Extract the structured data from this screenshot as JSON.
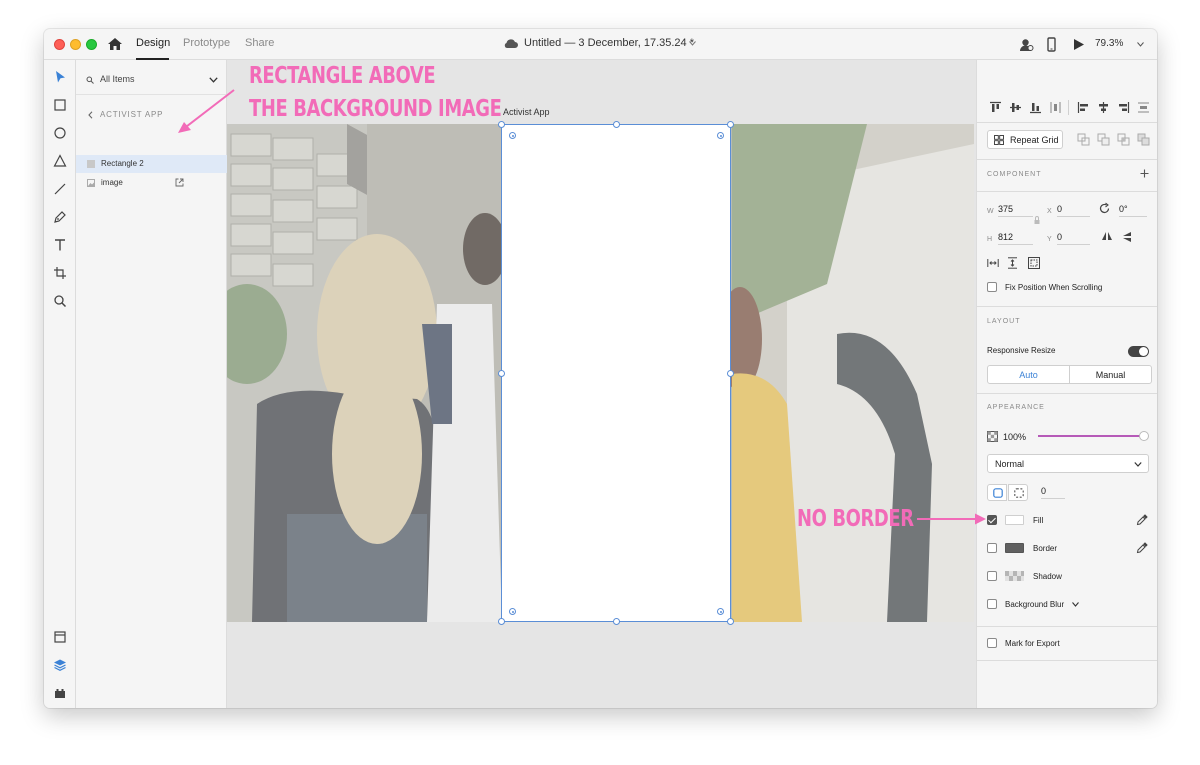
{
  "titlebar": {
    "tabs": [
      "Design",
      "Prototype",
      "Share"
    ],
    "active_tab": "Design",
    "document_title": "Untitled — 3 December, 17.35.24 *",
    "zoom": "79.3%"
  },
  "layers": {
    "filter_label": "All Items",
    "artboard_name": "ACTIVIST APP",
    "items": [
      {
        "name": "Rectangle 2",
        "selected": true
      },
      {
        "name": "image",
        "selected": false
      }
    ]
  },
  "canvas": {
    "artboard_label": "Activist App"
  },
  "annotations": {
    "line1": "RECTANGLE ABOVE",
    "line2": "THE BACKGROUND IMAGE",
    "border_note": "NO BORDER",
    "color": "#f26bb8"
  },
  "inspector": {
    "repeat_grid_label": "Repeat Grid",
    "component_title": "COMPONENT",
    "width_label": "W",
    "width": "375",
    "height_label": "H",
    "height": "812",
    "x_label": "X",
    "x": "0",
    "y_label": "Y",
    "y": "0",
    "rotation": "0°",
    "fix_position_label": "Fix Position When Scrolling",
    "layout_title": "LAYOUT",
    "responsive_resize_label": "Responsive Resize",
    "responsive_resize_on": true,
    "resize_options": [
      "Auto",
      "Manual"
    ],
    "resize_selected": "Auto",
    "appearance_title": "APPEARANCE",
    "opacity": "100%",
    "blend_mode": "Normal",
    "corner_radius": "0",
    "fill_label": "Fill",
    "fill_checked": true,
    "fill_color": "#ffffff",
    "border_label": "Border",
    "border_checked": false,
    "border_color": "#606060",
    "shadow_label": "Shadow",
    "shadow_checked": false,
    "background_blur_label": "Background Blur",
    "background_blur_checked": false,
    "export_label": "Mark for Export",
    "export_checked": false
  },
  "colors": {
    "selection": "#5b8ed6",
    "opacity_slider": "#b65ab8",
    "accent": "#3b82d6"
  }
}
